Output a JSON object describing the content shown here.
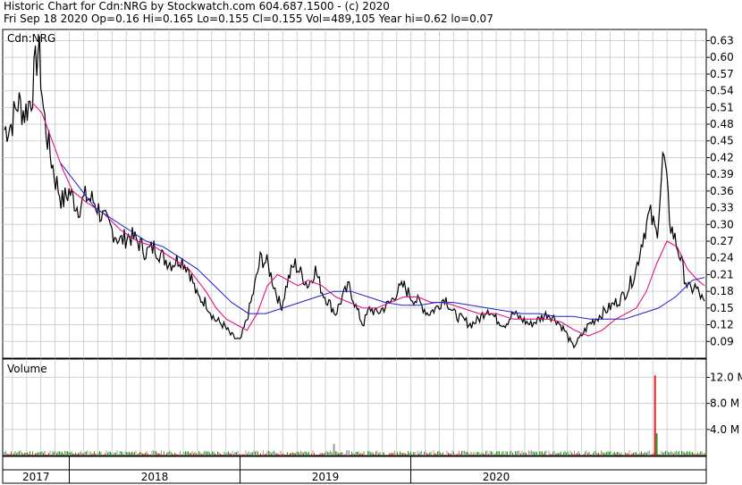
{
  "header": {
    "line1": "Historic Chart for Cdn:NRG by Stockwatch.com 604.687.1500 - (c) 2020",
    "line2": "Fri Sep 18 2020  Op=0.16  Hi=0.165  Lo=0.155  Cl=0.155  Vol=489,105  Year hi=0.62  lo=0.07"
  },
  "chart_data": [
    {
      "type": "line",
      "title": "Cdn:NRG",
      "y_axis_position": "right",
      "ylim": [
        0.06,
        0.65
      ],
      "y_ticks": [
        "0.09",
        "0.12",
        "0.15",
        "0.18",
        "0.21",
        "0.24",
        "0.27",
        "0.30",
        "0.33",
        "0.36",
        "0.39",
        "0.42",
        "0.45",
        "0.48",
        "0.51",
        "0.54",
        "0.57",
        "0.60",
        "0.63"
      ],
      "x_labels": [
        "2017",
        "2018",
        "2019",
        "2020"
      ],
      "grid": true,
      "colors": {
        "price": "#000000",
        "ma_short": "#e0007a",
        "ma_long": "#1f1fcc"
      },
      "series": [
        {
          "key": "price",
          "x": [
            2016.62,
            2016.66,
            2016.7,
            2016.74,
            2016.78,
            2016.8,
            2016.82,
            2016.85,
            2016.88,
            2016.92,
            2016.96,
            2017.0,
            2017.05,
            2017.1,
            2017.15,
            2017.2,
            2017.25,
            2017.3,
            2017.35,
            2017.4,
            2017.45,
            2017.5,
            2017.55,
            2017.6,
            2017.65,
            2017.7,
            2017.75,
            2017.8,
            2017.85,
            2017.9,
            2017.95,
            2018.0,
            2018.04,
            2018.08,
            2018.12,
            2018.16,
            2018.2,
            2018.24,
            2018.28,
            2018.32,
            2018.36,
            2018.4,
            2018.44,
            2018.48,
            2018.52,
            2018.56,
            2018.6,
            2018.64,
            2018.68,
            2018.72,
            2018.76,
            2018.8,
            2018.84,
            2018.88,
            2018.92,
            2018.96,
            2019.0,
            2019.05,
            2019.1,
            2019.15,
            2019.2,
            2019.25,
            2019.3,
            2019.35,
            2019.4,
            2019.45,
            2019.5,
            2019.55,
            2019.6,
            2019.65,
            2019.7,
            2019.75,
            2019.8,
            2019.85,
            2019.9,
            2019.95,
            2020.0,
            2020.04,
            2020.08,
            2020.12,
            2020.16,
            2020.2,
            2020.24,
            2020.28,
            2020.32,
            2020.36,
            2020.4,
            2020.44,
            2020.48,
            2020.52,
            2020.56,
            2020.58,
            2020.6,
            2020.62,
            2020.64,
            2020.66,
            2020.68,
            2020.7,
            2020.72
          ],
          "values": [
            0.47,
            0.48,
            0.52,
            0.5,
            0.53,
            0.58,
            0.62,
            0.5,
            0.44,
            0.38,
            0.34,
            0.36,
            0.33,
            0.35,
            0.34,
            0.31,
            0.29,
            0.27,
            0.28,
            0.27,
            0.25,
            0.26,
            0.24,
            0.23,
            0.24,
            0.22,
            0.17,
            0.16,
            0.13,
            0.12,
            0.1,
            0.09,
            0.13,
            0.18,
            0.24,
            0.23,
            0.19,
            0.15,
            0.2,
            0.23,
            0.21,
            0.19,
            0.22,
            0.18,
            0.16,
            0.14,
            0.17,
            0.19,
            0.15,
            0.12,
            0.15,
            0.14,
            0.15,
            0.16,
            0.18,
            0.19,
            0.17,
            0.16,
            0.14,
            0.15,
            0.17,
            0.14,
            0.13,
            0.12,
            0.13,
            0.15,
            0.13,
            0.12,
            0.14,
            0.13,
            0.12,
            0.13,
            0.14,
            0.13,
            0.11,
            0.08,
            0.1,
            0.12,
            0.13,
            0.14,
            0.15,
            0.16,
            0.17,
            0.19,
            0.22,
            0.28,
            0.32,
            0.28,
            0.43,
            0.3,
            0.26,
            0.24,
            0.21,
            0.19,
            0.18,
            0.19,
            0.18,
            0.17,
            0.155
          ]
        },
        {
          "key": "ma_short",
          "x": [
            2016.78,
            2016.84,
            2016.9,
            2016.96,
            2017.02,
            2017.1,
            2017.2,
            2017.3,
            2017.4,
            2017.5,
            2017.6,
            2017.7,
            2017.8,
            2017.86,
            2017.92,
            2017.98,
            2018.04,
            2018.1,
            2018.16,
            2018.22,
            2018.28,
            2018.34,
            2018.4,
            2018.48,
            2018.56,
            2018.64,
            2018.72,
            2018.8,
            2018.88,
            2018.96,
            2019.04,
            2019.12,
            2019.2,
            2019.3,
            2019.4,
            2019.5,
            2019.6,
            2019.7,
            2019.8,
            2019.88,
            2019.96,
            2020.04,
            2020.12,
            2020.2,
            2020.26,
            2020.32,
            2020.38,
            2020.44,
            2020.5,
            2020.56,
            2020.62,
            2020.68,
            2020.72
          ],
          "values": [
            0.52,
            0.5,
            0.45,
            0.4,
            0.36,
            0.34,
            0.32,
            0.29,
            0.27,
            0.26,
            0.24,
            0.22,
            0.18,
            0.15,
            0.13,
            0.12,
            0.11,
            0.14,
            0.19,
            0.21,
            0.2,
            0.19,
            0.2,
            0.19,
            0.17,
            0.16,
            0.15,
            0.15,
            0.16,
            0.17,
            0.17,
            0.16,
            0.16,
            0.15,
            0.14,
            0.14,
            0.13,
            0.13,
            0.13,
            0.125,
            0.11,
            0.1,
            0.11,
            0.13,
            0.14,
            0.15,
            0.18,
            0.23,
            0.27,
            0.26,
            0.22,
            0.2,
            0.19
          ]
        },
        {
          "key": "ma_long",
          "x": [
            2016.95,
            2017.05,
            2017.15,
            2017.25,
            2017.35,
            2017.45,
            2017.55,
            2017.65,
            2017.75,
            2017.85,
            2017.95,
            2018.05,
            2018.15,
            2018.25,
            2018.35,
            2018.45,
            2018.55,
            2018.65,
            2018.75,
            2018.85,
            2018.95,
            2019.05,
            2019.15,
            2019.25,
            2019.35,
            2019.45,
            2019.55,
            2019.65,
            2019.75,
            2019.85,
            2019.95,
            2020.05,
            2020.15,
            2020.25,
            2020.35,
            2020.45,
            2020.55,
            2020.65,
            2020.72
          ],
          "values": [
            0.41,
            0.37,
            0.33,
            0.31,
            0.29,
            0.27,
            0.26,
            0.24,
            0.22,
            0.19,
            0.16,
            0.14,
            0.14,
            0.15,
            0.16,
            0.17,
            0.18,
            0.18,
            0.17,
            0.16,
            0.155,
            0.155,
            0.16,
            0.16,
            0.155,
            0.15,
            0.145,
            0.14,
            0.14,
            0.135,
            0.135,
            0.13,
            0.13,
            0.13,
            0.14,
            0.15,
            0.17,
            0.2,
            0.205
          ]
        }
      ]
    },
    {
      "type": "bar",
      "title": "Volume",
      "y_axis_position": "right",
      "ylim": [
        0,
        14.8
      ],
      "y_ticks": [
        "4.0 M",
        "8.0 M",
        "12.0 M"
      ],
      "colors": {
        "up": "#2e9e2e",
        "down": "#e02020",
        "flat": "#999999"
      },
      "notable_bars": [
        {
          "x": 2020.43,
          "value": 12.3,
          "direction": "down"
        },
        {
          "x": 2020.44,
          "value": 3.4,
          "direction": "up"
        },
        {
          "x": 2018.55,
          "value": 1.8,
          "direction": "flat"
        }
      ],
      "baseline_typical": 0.45
    }
  ]
}
